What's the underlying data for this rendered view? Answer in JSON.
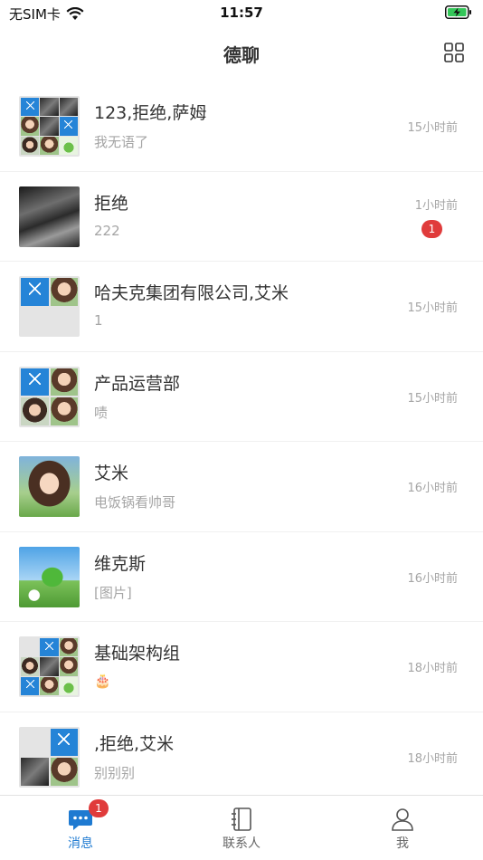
{
  "status_bar": {
    "carrier": "无SIM卡",
    "time": "11:57"
  },
  "header": {
    "title": "德聊"
  },
  "conversations": [
    {
      "name": "123,拒绝,萨姆",
      "preview": "我无语了",
      "time": "15小时前"
    },
    {
      "name": "拒绝",
      "preview": "222",
      "time": "1小时前",
      "unread": "1"
    },
    {
      "name": "哈夫克集团有限公司,艾米",
      "preview": "1",
      "time": "15小时前"
    },
    {
      "name": "产品运营部",
      "preview": "啧",
      "time": "15小时前"
    },
    {
      "name": "艾米",
      "preview": "电饭锅看帅哥",
      "time": "16小时前"
    },
    {
      "name": "维克斯",
      "preview": "[图片]",
      "time": "16小时前"
    },
    {
      "name": "基础架构组",
      "preview": "🎂",
      "time": "18小时前"
    },
    {
      "name": ",拒绝,艾米",
      "preview": "别别别",
      "time": "18小时前"
    }
  ],
  "tabs": [
    {
      "label": "消息",
      "badge": "1"
    },
    {
      "label": "联系人"
    },
    {
      "label": "我"
    }
  ],
  "colors": {
    "accent": "#1e7ad1",
    "badge": "#e03b3b",
    "muted_text": "#a5a5a5"
  }
}
